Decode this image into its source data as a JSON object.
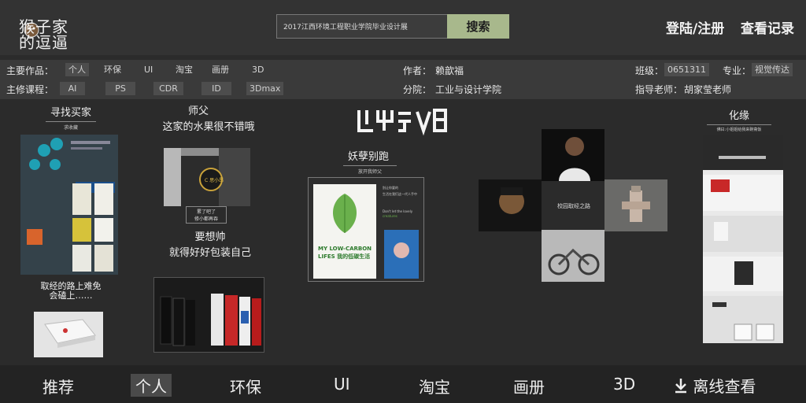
{
  "header": {
    "logo_text": "猴子家的逗逼",
    "search_value": "2017江西环境工程职业学院毕业设计展",
    "search_button": "搜索",
    "login_link": "登陆/注册",
    "history_link": "查看记录"
  },
  "info": {
    "works_label": "主要作品：",
    "works_tags": [
      "个人",
      "环保",
      "UI",
      "淘宝",
      "画册",
      "3D"
    ],
    "author_label": "作者：",
    "author": "赖歆福",
    "class_label": "班级：",
    "class_value": "0651311",
    "major_label": "专业：",
    "major_value": "视觉传达",
    "course_label": "主修课程：",
    "course_tags": [
      "AI",
      "PS",
      "CDR",
      "ID",
      "3Dmax"
    ],
    "college_label": "分院：",
    "college": "工业与设计学院",
    "teacher_label": "指导老师：",
    "teacher": "胡家莹老师"
  },
  "gallery": {
    "p1_title": "寻找买家",
    "p1_sub": "求收藏",
    "p1_bottom": "取经的路上难免\n会磕上……",
    "p2_title": "师父",
    "p2_title2": "这家的水果很不错哦",
    "p2_pill": "累了吧了\n修小都再吞",
    "p3_title": "要想帅",
    "p3_title2": "就得好好包装自己",
    "center_logo": "毕业设计",
    "p4_title": "妖孽别跑",
    "p4_sub": "放开我师父",
    "poster_title": "MY LOW-CARBON LIFES我的低碳生活",
    "poster_text": "别让你要的生活在我们这一代人手中消失\nDon't let the lovely creatures in the hands of our generation",
    "p5_label": "校园取经之路",
    "p6_title": "化缘",
    "p6_sub": "佛曰:小姐姐给我来碗斋饭"
  },
  "bottom_nav": {
    "items": [
      "推荐",
      "个人",
      "环保",
      "UI",
      "淘宝",
      "画册",
      "3D"
    ],
    "offline": "离线查看"
  },
  "colors": {
    "accent": "#a8b88c",
    "background": "#2b2b2b"
  }
}
